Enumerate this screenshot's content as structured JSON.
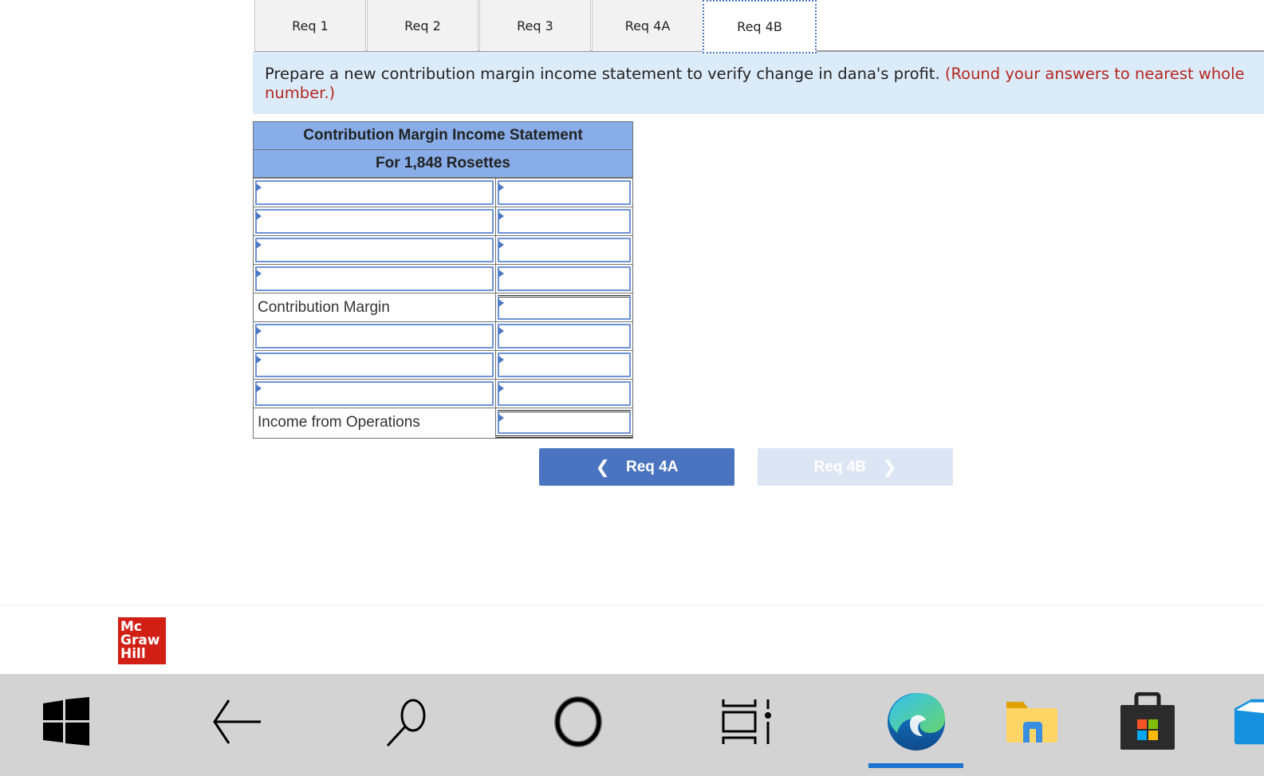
{
  "tabs": [
    {
      "label": "Req 1",
      "active": false
    },
    {
      "label": "Req 2",
      "active": false
    },
    {
      "label": "Req 3",
      "active": false
    },
    {
      "label": "Req 4A",
      "active": false
    },
    {
      "label": "Req 4B",
      "active": true
    }
  ],
  "instruction": {
    "text": "Prepare a new contribution margin income statement to verify change in dana's profit.",
    "note": "(Round your answers to nearest whole number.)"
  },
  "statement": {
    "title": "Contribution Margin Income Statement",
    "subtitle": "For 1,848 Rosettes",
    "rows": [
      {
        "label": "",
        "value": "",
        "label_editable": true
      },
      {
        "label": "",
        "value": "",
        "label_editable": true
      },
      {
        "label": "",
        "value": "",
        "label_editable": true
      },
      {
        "label": "",
        "value": "",
        "label_editable": true
      },
      {
        "label": "Contribution Margin",
        "value": "",
        "label_editable": false
      },
      {
        "label": "",
        "value": "",
        "label_editable": true
      },
      {
        "label": "",
        "value": "",
        "label_editable": true
      },
      {
        "label": "",
        "value": "",
        "label_editable": true
      },
      {
        "label": "Income from Operations",
        "value": "",
        "label_editable": false
      }
    ]
  },
  "nav": {
    "prev_label": "Req 4A",
    "next_label": "Req 4B",
    "prev_color": "#4a74c0",
    "next_color": "#dce5f3"
  },
  "logo": {
    "lines": [
      "Mc",
      "Graw",
      "Hill"
    ],
    "color": "#d11f15"
  },
  "taskbar": {
    "icons": [
      "windows-start-icon",
      "back-arrow-icon",
      "search-icon",
      "cortana-icon",
      "task-view-icon",
      "edge-browser-icon",
      "file-explorer-icon",
      "microsoft-store-icon",
      "mail-icon"
    ],
    "active": "edge-browser-icon"
  }
}
